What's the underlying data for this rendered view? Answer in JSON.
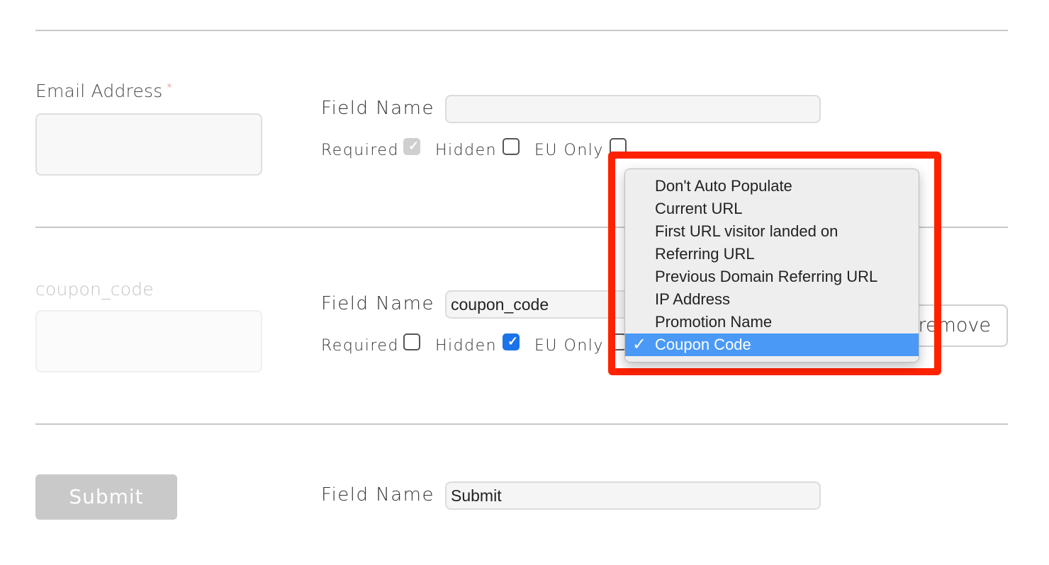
{
  "rows": [
    {
      "preview_label": "Email Address",
      "required_marker": "*",
      "field_name_label": "Field Name",
      "field_name_value": "",
      "options": {
        "required": "Required",
        "hidden": "Hidden",
        "eu_only": "EU Only"
      },
      "required_checked": true,
      "hidden_checked": false,
      "eu_only_checked": false
    },
    {
      "preview_label": "coupon_code",
      "field_name_label": "Field Name",
      "field_name_value": "coupon_code",
      "options": {
        "required": "Required",
        "hidden": "Hidden",
        "eu_only": "EU Only"
      },
      "required_checked": false,
      "hidden_checked": true,
      "eu_only_checked": false,
      "remove_label": "remove"
    },
    {
      "preview_label": "Submit",
      "field_name_label": "Field Name",
      "field_name_value": "Submit"
    }
  ],
  "dropdown": {
    "items": [
      "Don't Auto Populate",
      "Current URL",
      "First URL visitor landed on",
      "Referring URL",
      "Previous Domain Referring URL",
      "IP Address",
      "Promotion Name",
      "Coupon Code"
    ],
    "selected": "Coupon Code",
    "check_glyph": "✓",
    "highlight_color": "#ff2200",
    "selected_color": "#4a99f7"
  }
}
